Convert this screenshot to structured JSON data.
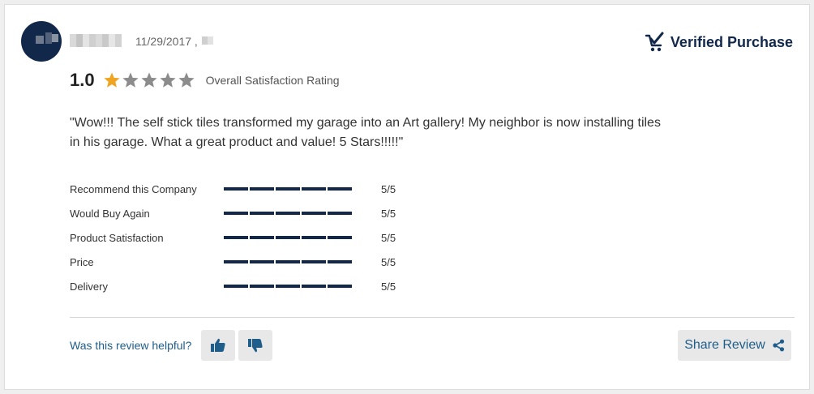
{
  "reviewer": {
    "date": "11/29/2017 ,"
  },
  "verified": {
    "label": "Verified Purchase",
    "icon": "verified-cart-check-icon",
    "color": "#12284b"
  },
  "overall": {
    "value": "1.0",
    "stars_filled": 1,
    "stars_total": 5,
    "label": "Overall Satisfaction Rating",
    "star_color": "#f0a522",
    "star_empty_color": "#8c8c8c"
  },
  "review": {
    "text": "\"Wow!!! The self stick tiles transformed my garage into an Art gallery! My neighbor is now installing tiles in his garage. What a great product and value! 5 Stars!!!!!\""
  },
  "sub_ratings": [
    {
      "label": "Recommend this Company",
      "score": 5,
      "max": 5,
      "value_text": "5/5"
    },
    {
      "label": "Would Buy Again",
      "score": 5,
      "max": 5,
      "value_text": "5/5"
    },
    {
      "label": "Product Satisfaction",
      "score": 5,
      "max": 5,
      "value_text": "5/5"
    },
    {
      "label": "Price",
      "score": 5,
      "max": 5,
      "value_text": "5/5"
    },
    {
      "label": "Delivery",
      "score": 5,
      "max": 5,
      "value_text": "5/5"
    }
  ],
  "footer": {
    "helpful_label": "Was this review helpful?",
    "thumbs_up_icon": "thumbs-up-icon",
    "thumbs_down_icon": "thumbs-down-icon",
    "share_label": "Share Review",
    "share_icon": "share-icon",
    "link_color": "#1f5d8a"
  }
}
